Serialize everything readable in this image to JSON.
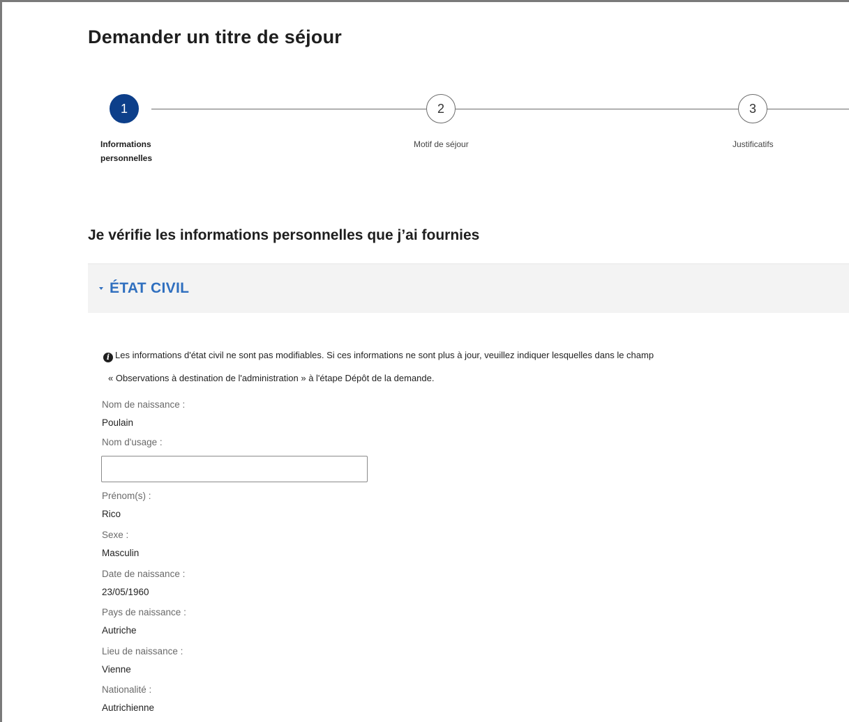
{
  "page": {
    "title": "Demander un titre de séjour"
  },
  "stepper": {
    "steps": [
      {
        "number": "1",
        "label_line1": "Informations",
        "label_line2": "personnelles",
        "state": "active"
      },
      {
        "number": "2",
        "label": "Motif de séjour",
        "state": "inactive"
      },
      {
        "number": "3",
        "label": "Justificatifs",
        "state": "inactive"
      }
    ],
    "active_color": "#0d3f8a"
  },
  "section": {
    "heading": "Je vérifie les informations personnelles que j’ai fournies",
    "accordion_title": "ÉTAT CIVIL",
    "accordion_color": "#2f6fbf"
  },
  "info": {
    "icon": "info-icon",
    "line1": "Les informations d'état civil ne sont pas modifiables. Si ces informations ne sont plus à jour, veuillez indiquer lesquelles dans le champ",
    "line2": "« Observations à destination de l'administration » à l'étape Dépôt de la demande."
  },
  "fields": {
    "nom_naissance": {
      "label": "Nom de naissance :",
      "value": "Poulain"
    },
    "nom_usage": {
      "label": "Nom d'usage :",
      "value": ""
    },
    "prenoms": {
      "label": "Prénom(s) :",
      "value": "Rico"
    },
    "sexe": {
      "label": "Sexe :",
      "value": "Masculin"
    },
    "date_naissance": {
      "label": "Date de naissance :",
      "value": "23/05/1960"
    },
    "pays_naissance": {
      "label": "Pays de naissance :",
      "value": "Autriche"
    },
    "lieu_naissance": {
      "label": "Lieu de naissance :",
      "value": "Vienne"
    },
    "nationalite": {
      "label": "Nationalité :",
      "value": "Autrichienne"
    }
  }
}
